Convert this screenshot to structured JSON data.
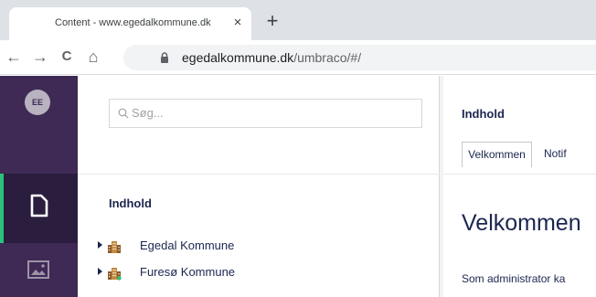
{
  "browser": {
    "tab_title": "Content - www.egedalkommune.dk",
    "tab_close": "×",
    "new_tab": "+",
    "back": "←",
    "forward": "→",
    "reload": "C",
    "home": "⌂",
    "url_host": "egedalkommune.dk",
    "url_path": "/umbraco/#/"
  },
  "sections": {
    "avatar_initials": "EE",
    "active_accent": "#2bc37c",
    "background": "#3e2a55"
  },
  "tree": {
    "search_placeholder": "Søg...",
    "heading": "Indhold",
    "items": [
      {
        "label": "Egedal Kommune",
        "icon": "building-icon"
      },
      {
        "label": "Furesø Kommune",
        "icon": "building-icon"
      }
    ]
  },
  "editor": {
    "title": "Indhold",
    "tabs": [
      "Velkommen",
      "Notif"
    ],
    "heading": "Velkommen",
    "text": "Som administrator ka"
  }
}
